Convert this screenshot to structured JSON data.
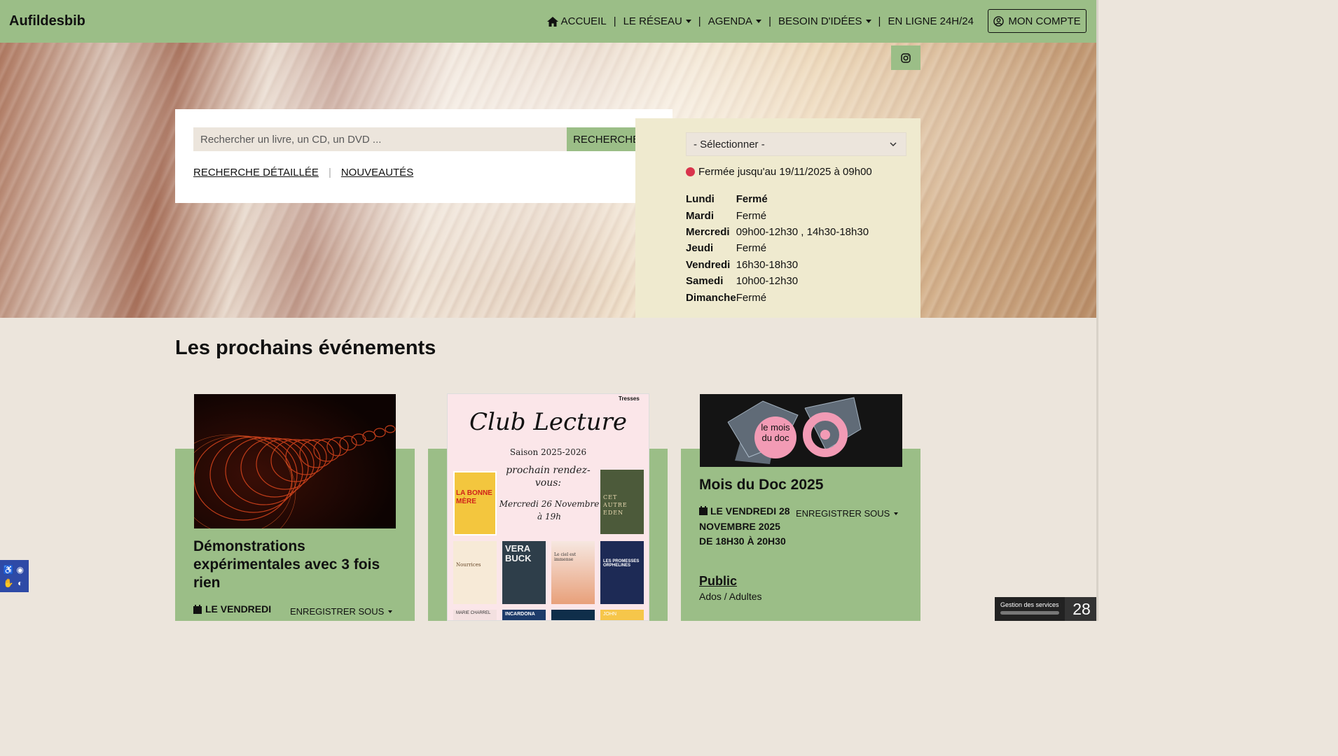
{
  "header": {
    "brand": "Aufildesbib",
    "nav": [
      {
        "label": "ACCUEIL",
        "icon": "home-icon",
        "dropdown": false
      },
      {
        "label": "LE RÉSEAU",
        "dropdown": true
      },
      {
        "label": "AGENDA",
        "dropdown": true
      },
      {
        "label": "BESOIN D'IDÉES",
        "dropdown": true
      },
      {
        "label": "EN LIGNE 24H/24",
        "dropdown": false
      }
    ],
    "separator": "|",
    "account_label": "MON COMPTE",
    "account_icon": "user-circle-icon"
  },
  "hero": {
    "social_icon": "instagram-icon"
  },
  "search": {
    "placeholder": "Rechercher un livre, un CD, un DVD ...",
    "button_label": "RECHERCHER",
    "link_detailed": "RECHERCHE DÉTAILLÉE",
    "link_separator": "|",
    "link_new": "NOUVEAUTÉS"
  },
  "hours": {
    "select_label": "- Sélectionner -",
    "status": "Fermée jusqu'au 19/11/2025 à 09h00",
    "status_color": "#d9344c",
    "days": [
      {
        "day": "Lundi",
        "hours": "Fermé",
        "today": true
      },
      {
        "day": "Mardi",
        "hours": "Fermé",
        "today": false
      },
      {
        "day": "Mercredi",
        "hours": "09h00-12h30 , 14h30-18h30",
        "today": false
      },
      {
        "day": "Jeudi",
        "hours": "Fermé",
        "today": false
      },
      {
        "day": "Vendredi",
        "hours": "16h30-18h30",
        "today": false
      },
      {
        "day": "Samedi",
        "hours": "10h00-12h30",
        "today": false
      },
      {
        "day": "Dimanche",
        "hours": "Fermé",
        "today": false
      }
    ]
  },
  "events": {
    "title": "Les prochains événements",
    "cards": [
      {
        "title": "Démonstrations expérimentales avec 3 fois rien",
        "date": "LE VENDREDI",
        "register": "ENREGISTRER SOUS"
      },
      {
        "poster_title": "Club Lecture",
        "poster_season": "Saison 2025-2026",
        "poster_next": "prochain rendez-vous:",
        "poster_date": "Mercredi 26 Novembre à 19h",
        "poster_logo": "Tresses",
        "books": [
          "LA BONNE MÈRE",
          "CET AUTRE EDEN",
          "Nourrices",
          "VERA BUCK",
          "Le ciel est immense",
          "LES PROMESSES ORPHELINES",
          "MARIE CHARREL",
          "INCARDONA",
          "JOHN"
        ]
      },
      {
        "poster_text": "le mois du doc",
        "title": "Mois du Doc 2025",
        "date": "LE VENDREDI 28 NOVEMBRE 2025 DE 18H30 À 20H30",
        "register": "ENREGISTRER SOUS",
        "public_label": "Public",
        "public_value": "Ados / Adultes"
      }
    ]
  },
  "widgets": {
    "services_label": "Gestion des services",
    "services_count": "28"
  },
  "colors": {
    "accent_green": "#9bbe87",
    "page_bg": "#ece5dc",
    "hours_bg": "#efeacf",
    "a11y_blue": "#2e4aa6"
  }
}
